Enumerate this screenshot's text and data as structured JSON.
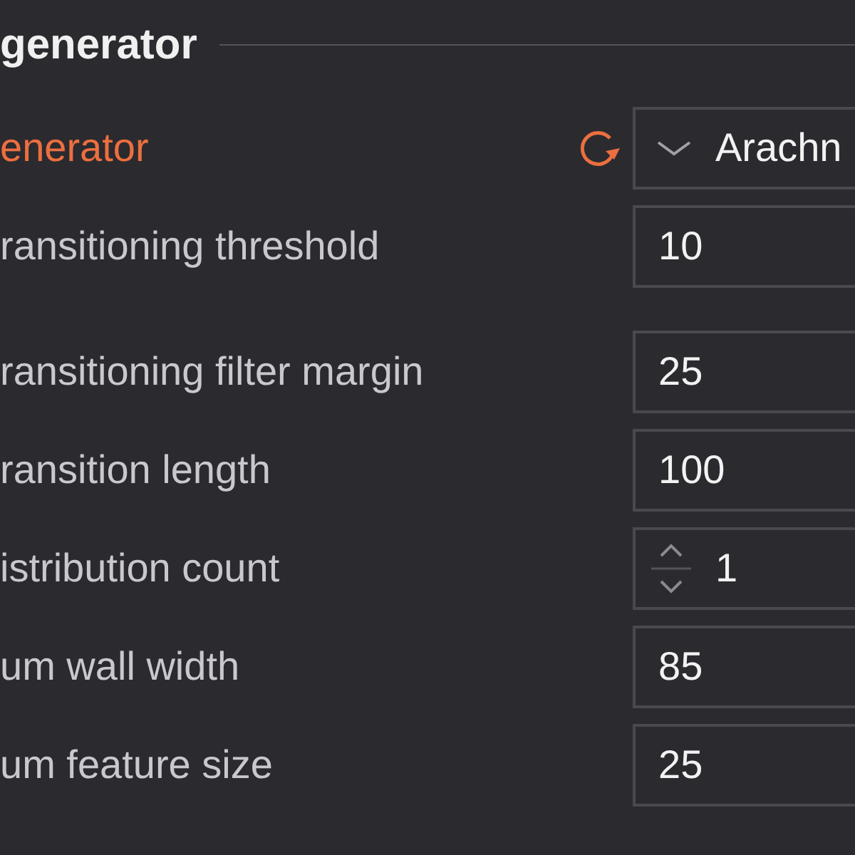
{
  "section": {
    "title": "generator"
  },
  "settings": [
    {
      "kind": "dropdown",
      "label": "enerator",
      "value": "Arachn",
      "modified": true
    },
    {
      "kind": "number",
      "label": "ransitioning threshold",
      "value": "10",
      "modified": false
    },
    {
      "kind": "number",
      "label": "ransitioning filter margin",
      "value": "25",
      "modified": false
    },
    {
      "kind": "number",
      "label": "ransition length",
      "value": "100",
      "modified": false
    },
    {
      "kind": "spinner",
      "label": "istribution count",
      "value": "1",
      "modified": false
    },
    {
      "kind": "number",
      "label": "um wall width",
      "value": "85",
      "modified": false
    },
    {
      "kind": "number",
      "label": "um feature size",
      "value": "25",
      "modified": false
    }
  ]
}
